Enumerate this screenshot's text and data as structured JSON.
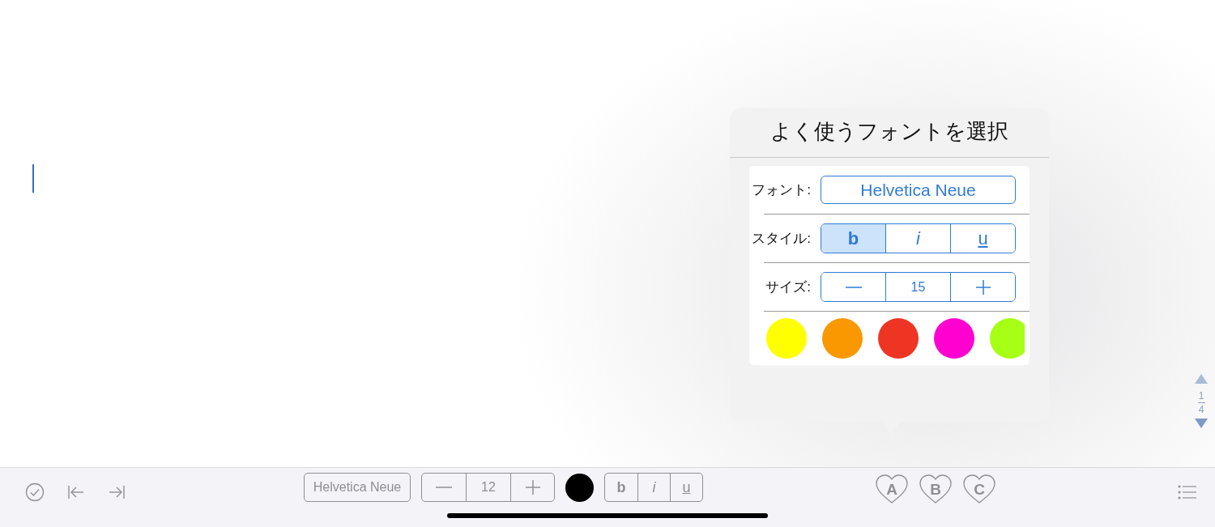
{
  "popover": {
    "title": "よく使うフォントを選択",
    "font_label": "フォント:",
    "font_value": "Helvetica Neue",
    "style_label": "スタイル:",
    "styles": [
      {
        "label": "b",
        "kind": "bold",
        "selected": true
      },
      {
        "label": "i",
        "kind": "italic",
        "selected": false
      },
      {
        "label": "u",
        "kind": "underline",
        "selected": false
      }
    ],
    "size_label": "サイズ:",
    "size_value": "15",
    "colors": [
      {
        "color": "#ffff00"
      },
      {
        "color": "#f99800"
      },
      {
        "color": "#ee3524"
      },
      {
        "color": "#ff00d0"
      },
      {
        "color": "#a6ff14"
      }
    ]
  },
  "page_indicator": {
    "current": "1",
    "total": "4"
  },
  "toolbar": {
    "font": "Helvetica Neue",
    "size": "12",
    "styles": [
      {
        "label": "b",
        "kind": "bold"
      },
      {
        "label": "i",
        "kind": "italic"
      },
      {
        "label": "u",
        "kind": "underline"
      }
    ],
    "hearts": [
      "A",
      "B",
      "C"
    ]
  }
}
